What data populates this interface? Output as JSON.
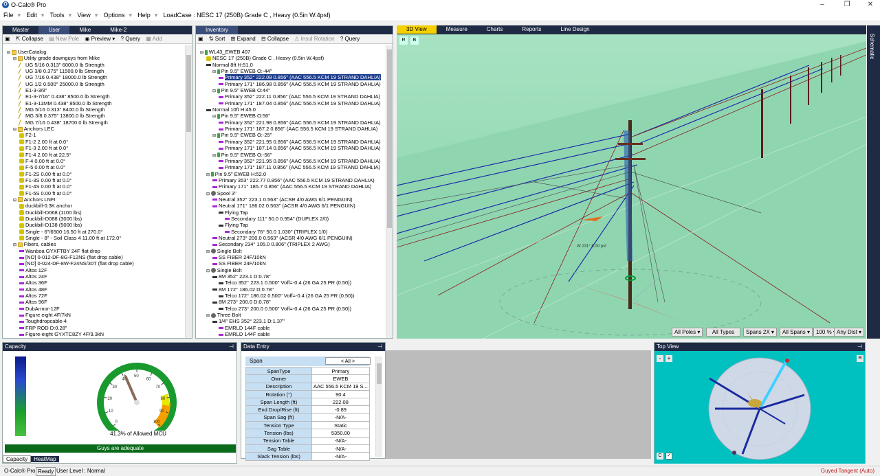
{
  "app": {
    "title": "O-Calc® Pro"
  },
  "menu": {
    "items": [
      "File",
      "Edit",
      "Tools",
      "View",
      "Options",
      "Help"
    ],
    "loadcase": "LoadCase : NESC  17 (250B) Grade C , Heavy (0.5in W.4psf)"
  },
  "left_panel": {
    "tabs": [
      "Master",
      "User",
      "Mike",
      "Mike-2"
    ],
    "toolbar": {
      "collapse": "Collapse",
      "new_pole": "New Pole",
      "preview": "Preview",
      "query": "Query",
      "add": "Add"
    },
    "tree": [
      {
        "d": 0,
        "i": "folder",
        "t": "UserCatalog"
      },
      {
        "d": 1,
        "i": "folder",
        "t": "Utility grade downguys from Mike"
      },
      {
        "d": 2,
        "i": "guy",
        "t": "UG 5/16  0.313\"  6000.0 lb Strength"
      },
      {
        "d": 2,
        "i": "guy",
        "t": "UG 3/8  0.375\"  11500.0 lb Strength"
      },
      {
        "d": 2,
        "i": "guy",
        "t": "UG 7/16  0.438\"  18000.0 lb Strength"
      },
      {
        "d": 2,
        "i": "guy",
        "t": "UG 1/2  0.500\"  25000.0 lb Strength"
      },
      {
        "d": 2,
        "i": "guy",
        "t": "E1-3-3/8\""
      },
      {
        "d": 2,
        "i": "guy",
        "t": "E1-3-7/16\"  0.438\"  8500.0 lb Strength"
      },
      {
        "d": 2,
        "i": "guy",
        "t": "E1-3-11MM  0.438\"  8500.0 lb Strength"
      },
      {
        "d": 2,
        "i": "guy",
        "t": "MG 5/16  0.313\"  8400.0 lb Strength"
      },
      {
        "d": 2,
        "i": "guy",
        "t": "MG 3/8  0.375\"  13800.0 lb Strength"
      },
      {
        "d": 2,
        "i": "guy",
        "t": "MG 7/16  0.438\"  18700.0 lb Strength"
      },
      {
        "d": 1,
        "i": "folder",
        "t": "Anchors LEC"
      },
      {
        "d": 2,
        "i": "anchor",
        "t": "F2-1"
      },
      {
        "d": 2,
        "i": "anchor",
        "t": "F1-2 2.00 ft at 0.0°"
      },
      {
        "d": 2,
        "i": "anchor",
        "t": "F1-3 2.00 ft at 0.0°"
      },
      {
        "d": 2,
        "i": "anchor",
        "t": "F1-4 2.00 ft at 22.5°"
      },
      {
        "d": 2,
        "i": "anchor",
        "t": "F-4 0.00 ft at 0.0°"
      },
      {
        "d": 2,
        "i": "anchor",
        "t": "F-5 0.00 ft at 0.0°"
      },
      {
        "d": 2,
        "i": "anchor",
        "t": "F1-2S 0.00 ft at 0.0°"
      },
      {
        "d": 2,
        "i": "anchor",
        "t": "F1-3S 0.00 ft at 0.0°"
      },
      {
        "d": 2,
        "i": "anchor",
        "t": "F1-4S 0.00 ft at 0.0°"
      },
      {
        "d": 2,
        "i": "anchor",
        "t": "F1-5S 0.00 ft at 0.0°"
      },
      {
        "d": 1,
        "i": "folder",
        "t": "Anchors LNFI"
      },
      {
        "d": 2,
        "i": "anchor",
        "t": "duckbill-0.3K anchor"
      },
      {
        "d": 2,
        "i": "anchor",
        "t": "Duckbill-D068 (1100 lbs)"
      },
      {
        "d": 2,
        "i": "anchor",
        "t": "Duckbill-D088 (3000 lbs)"
      },
      {
        "d": 2,
        "i": "anchor",
        "t": "Duckbill-D138 (5000 lbs)"
      },
      {
        "d": 2,
        "i": "anchor",
        "t": "Single - 6\"/6500 16.50 ft at 270.0°"
      },
      {
        "d": 2,
        "i": "anchor",
        "t": "Single - 8\" - Soil Class 4 11.00 ft at 172.0°"
      },
      {
        "d": 1,
        "i": "folder",
        "t": "Fibers, cables"
      },
      {
        "d": 2,
        "i": "span",
        "t": "Wanboa GYXFTBY 24F flat drop"
      },
      {
        "d": 2,
        "i": "span",
        "t": "[NO] 0-012-DF-8G-F12NS (flat drop cable)"
      },
      {
        "d": 2,
        "i": "span",
        "t": "[NO] 0-024-DF-8W-F24NS/30T (flat drop cable)"
      },
      {
        "d": 2,
        "i": "span",
        "t": "Altos 12F"
      },
      {
        "d": 2,
        "i": "span",
        "t": "Altos 24F"
      },
      {
        "d": 2,
        "i": "span",
        "t": "Altos 36F"
      },
      {
        "d": 2,
        "i": "span",
        "t": "Altos 48F"
      },
      {
        "d": 2,
        "i": "span",
        "t": "Altos 72F"
      },
      {
        "d": 2,
        "i": "span",
        "t": "Altos 96F"
      },
      {
        "d": 2,
        "i": "span",
        "t": "DubArmor-12F"
      },
      {
        "d": 2,
        "i": "span",
        "t": "Figure eight 4F/7kN"
      },
      {
        "d": 2,
        "i": "span",
        "t": "Toughdropcable-4"
      },
      {
        "d": 2,
        "i": "span",
        "t": "FRP ROD  D:0.28\""
      },
      {
        "d": 2,
        "i": "span",
        "t": "Figure-eight GYXTC8ZY 4F/9.3kN"
      }
    ]
  },
  "inventory": {
    "tab": "Inventory",
    "toolbar": {
      "sort": "Sort",
      "expand": "Expand",
      "collapse": "Collapse",
      "insul": "Insul Rotation",
      "query": "Query"
    },
    "tree": [
      {
        "d": 0,
        "i": "pole",
        "t": "WL43_EWEB 407"
      },
      {
        "d": 1,
        "i": "anchor",
        "t": "NESC  17 (250B) Grade C , Heavy (0.5in W.4psf)"
      },
      {
        "d": 1,
        "i": "tel",
        "t": "Normal 8ft  H:51.0"
      },
      {
        "d": 2,
        "i": "pole",
        "t": "Pin 9.5\" EWEB O:-44\""
      },
      {
        "d": 3,
        "i": "span",
        "t": "Primary 352° 222.08  0.856\"  (AAC 556.5 KCM 19 STRAND DAHLIA)",
        "sel": true
      },
      {
        "d": 3,
        "i": "span",
        "t": "Primary 171° 186.98  0.856\"  (AAC 556.5 KCM 19 STRAND DAHLIA)"
      },
      {
        "d": 2,
        "i": "pole",
        "t": "Pin 9.5\" EWEB O:44\""
      },
      {
        "d": 3,
        "i": "span",
        "t": "Primary 352° 222.11  0.856\"  (AAC 556.5 KCM 19 STRAND DAHLIA)"
      },
      {
        "d": 3,
        "i": "span",
        "t": "Primary 171° 187.04  0.856\"  (AAC 556.5 KCM 19 STRAND DAHLIA)"
      },
      {
        "d": 1,
        "i": "tel",
        "t": "Normal 10ft  H:45.0"
      },
      {
        "d": 2,
        "i": "pole",
        "t": "Pin 9.5\" EWEB O:56\""
      },
      {
        "d": 3,
        "i": "span",
        "t": "Primary 352° 221.98  0.856\"  (AAC 556.5 KCM 19 STRAND DAHLIA)"
      },
      {
        "d": 3,
        "i": "span",
        "t": "Primary 171° 187.2  0.856\"  (AAC 556.5 KCM 19 STRAND DAHLIA)"
      },
      {
        "d": 2,
        "i": "pole",
        "t": "Pin 9.5\" EWEB O:-25\""
      },
      {
        "d": 3,
        "i": "span",
        "t": "Primary 352° 221.95  0.856\"  (AAC 556.5 KCM 19 STRAND DAHLIA)"
      },
      {
        "d": 3,
        "i": "span",
        "t": "Primary 171° 187.14  0.856\"  (AAC 556.5 KCM 19 STRAND DAHLIA)"
      },
      {
        "d": 2,
        "i": "pole",
        "t": "Pin 9.5\" EWEB O:-56\""
      },
      {
        "d": 3,
        "i": "span",
        "t": "Primary 352° 221.95  0.856\"  (AAC 556.5 KCM 19 STRAND DAHLIA)"
      },
      {
        "d": 3,
        "i": "span",
        "t": "Primary 171° 187.11  0.856\"  (AAC 556.5 KCM 19 STRAND DAHLIA)"
      },
      {
        "d": 1,
        "i": "pole",
        "t": "Pin 9.5\" EWEB H:52.0"
      },
      {
        "d": 2,
        "i": "span",
        "t": "Primary 353° 222.77  0.856\"  (AAC 556.5 KCM 19 STRAND DAHLIA)"
      },
      {
        "d": 2,
        "i": "span",
        "t": "Primary 171° 185.7  0.856\"  (AAC 556.5 KCM 19 STRAND DAHLIA)"
      },
      {
        "d": 1,
        "i": "spool",
        "t": "Spool 3\""
      },
      {
        "d": 2,
        "i": "span",
        "t": "Neutral 352° 223.1  0.563\"  (ACSR 4/0  AWG 6/1 PENGUIN)"
      },
      {
        "d": 2,
        "i": "span",
        "t": "Neutral 171° 186.02  0.563\"  (ACSR 4/0  AWG 6/1 PENGUIN)"
      },
      {
        "d": 3,
        "i": "tel",
        "t": "Flying Tap"
      },
      {
        "d": 4,
        "i": "span",
        "t": "Secondary 111° 50.0  0.954\"  (DUPLEX 2/0)"
      },
      {
        "d": 3,
        "i": "tel",
        "t": "Flying Tap"
      },
      {
        "d": 4,
        "i": "span",
        "t": "Secondary 76° 50.0  1.030\"  (TRIPLEX 1/0)"
      },
      {
        "d": 2,
        "i": "span",
        "t": "Neutral 273° 200.0  0.563\"  (ACSR 4/0  AWG 6/1 PENGUIN)"
      },
      {
        "d": 2,
        "i": "span",
        "t": "Secondary 234° 105.0  0.806\"  (TRIPLEX 2 AWG)"
      },
      {
        "d": 1,
        "i": "spool",
        "t": "Single Bolt"
      },
      {
        "d": 2,
        "i": "span",
        "t": "SS FIBER 24F/10kN"
      },
      {
        "d": 2,
        "i": "span",
        "t": "SS FIBER 24F/10kN"
      },
      {
        "d": 1,
        "i": "spool",
        "t": "Single Bolt"
      },
      {
        "d": 2,
        "i": "tel",
        "t": "8M 352° 223.1  D:0.78\""
      },
      {
        "d": 3,
        "i": "tel",
        "t": "Telco 352° 223.1  0.500\"  Voff=-0.4   (26 GA 25 PR (0.50))"
      },
      {
        "d": 2,
        "i": "tel",
        "t": "8M 172° 186.02  D:0.78\""
      },
      {
        "d": 3,
        "i": "tel",
        "t": "Telco 172° 186.02  0.500\"  Voff=-0.4   (26 GA 25 PR (0.50))"
      },
      {
        "d": 2,
        "i": "tel",
        "t": "8M 273° 200.0  D:0.78\""
      },
      {
        "d": 3,
        "i": "tel",
        "t": "Telco 273° 200.0  0.500\"  Voff=-0.4   (26 GA 25 PR (0.50))"
      },
      {
        "d": 1,
        "i": "spool",
        "t": "Three Bolt"
      },
      {
        "d": 2,
        "i": "tel",
        "t": "1/4\" EHS 352° 223.1  D:1.37\""
      },
      {
        "d": 3,
        "i": "span",
        "t": "EMRLD 144F cable"
      },
      {
        "d": 3,
        "i": "span",
        "t": "EMRLD 144F cable"
      }
    ]
  },
  "view3d": {
    "tabs": [
      "3D View",
      "Measure",
      "Charts",
      "Reports",
      "Line Design"
    ],
    "buttons": [
      "R",
      "B"
    ],
    "wind_label": "W 231° 6.00 psf",
    "controls": [
      "All Poles",
      "All Types",
      "Spans 2X",
      "All Spans",
      "100 %",
      "Any Dist"
    ]
  },
  "schematic": {
    "label": "Schematic"
  },
  "capacity": {
    "title": "Capacity",
    "percent_text": "41.3% of Allowed MCU",
    "value": 41.3,
    "scale": [
      "0",
      "10",
      "20",
      "30",
      "40",
      "50",
      "60",
      "70",
      "80",
      "90",
      "100"
    ],
    "status": "Guys are adequate",
    "tabs": [
      "Capacity",
      "HeatMap"
    ]
  },
  "data_entry": {
    "title": "Data Entry",
    "header_label": "Span",
    "header_value": "< All >",
    "rows": [
      {
        "label": "SpanType",
        "value": "Primary"
      },
      {
        "label": "Owner",
        "value": "EWEB"
      },
      {
        "label": "Description",
        "value": "AAC 556.5 KCM 19 S..."
      },
      {
        "label": "Rotation (°)",
        "value": "90.4"
      },
      {
        "label": "Span Length (ft)",
        "value": "222.08"
      },
      {
        "label": "End Drop/Rise (ft)",
        "value": "-0.89"
      },
      {
        "label": "Span Sag (ft)",
        "value": "-N/A-"
      },
      {
        "label": "Tension Type",
        "value": "Static"
      },
      {
        "label": "Tension (lbs)",
        "value": "5350.00"
      },
      {
        "label": "Tension Table",
        "value": "-N/A-"
      },
      {
        "label": "Sag Table",
        "value": "-N/A-"
      },
      {
        "label": "Slack Tension (lbs)",
        "value": "-N/A-"
      }
    ]
  },
  "top_view": {
    "title": "Top View",
    "buttons": [
      "-",
      "+",
      "R",
      "C"
    ]
  },
  "status": {
    "app": "O-Calc® Pro",
    "ready": "Ready",
    "user_level": "User Level : Normal",
    "right": "Guyed Tangent (Auto)"
  },
  "colors": {
    "accent": "#1f2a44",
    "selection": "#1b3d8f",
    "ground": "#93d8b2",
    "topview": "#00c0c0",
    "gauge_green": "#1a9a2e"
  }
}
